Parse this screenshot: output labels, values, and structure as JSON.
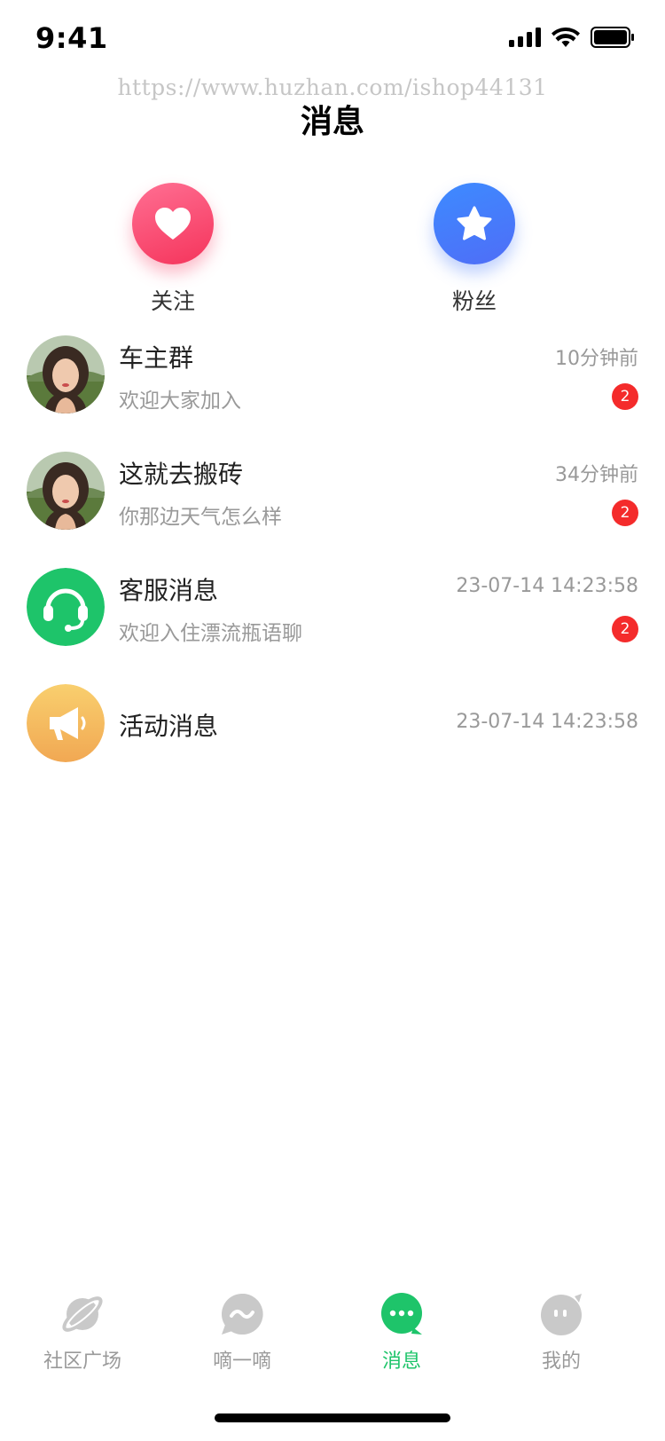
{
  "status_bar": {
    "time": "9:41"
  },
  "watermark": "https://www.huzhan.com/ishop44131",
  "header": {
    "title": "消息"
  },
  "quick_actions": [
    {
      "label": "关注",
      "icon": "heart-icon",
      "color": "#f5345b"
    },
    {
      "label": "粉丝",
      "icon": "star-icon",
      "color": "#4f6df7"
    }
  ],
  "conversations": [
    {
      "name": "车主群",
      "preview": "欢迎大家加入",
      "time": "10分钟前",
      "unread": "2",
      "avatar": "user-photo"
    },
    {
      "name": "这就去搬砖",
      "preview": "你那边天气怎么样",
      "time": "34分钟前",
      "unread": "2",
      "avatar": "user-photo"
    },
    {
      "name": "客服消息",
      "preview": "欢迎入住漂流瓶语聊",
      "time": "23-07-14 14:23:58",
      "unread": "2",
      "avatar": "headset-icon"
    },
    {
      "name": "活动消息",
      "preview": "",
      "time": "23-07-14 14:23:58",
      "unread": "",
      "avatar": "megaphone-icon"
    }
  ],
  "tabbar": {
    "items": [
      {
        "label": "社区广场",
        "icon": "planet-icon"
      },
      {
        "label": "嘀一嘀",
        "icon": "wave-bubble-icon"
      },
      {
        "label": "消息",
        "icon": "chat-bubble-icon",
        "active": true
      },
      {
        "label": "我的",
        "icon": "profile-face-icon"
      }
    ]
  },
  "colors": {
    "accent": "#1ec46a",
    "badge": "#f42b2b",
    "muted_text": "#999999"
  }
}
